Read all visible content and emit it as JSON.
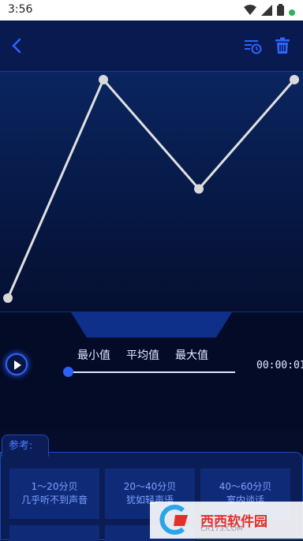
{
  "status_bar": {
    "time": "3:56",
    "icons": [
      "wifi-icon",
      "signal-icon",
      "battery-icon",
      "dot-icon"
    ]
  },
  "toolbar": {
    "back_icon": "chevron-left-icon",
    "history_icon": "history-list-icon",
    "delete_icon": "trash-icon",
    "accent_color": "#2e64ff"
  },
  "chart_data": {
    "type": "line",
    "points": [
      {
        "x": 0,
        "y": 0
      },
      {
        "x": 1,
        "y": 1
      },
      {
        "x": 2,
        "y": 0.5
      },
      {
        "x": 3,
        "y": 1
      }
    ],
    "grid": false,
    "colors": {
      "line": "#e0e0e0",
      "marker": "#d9d9d9"
    }
  },
  "stats": {
    "min_label": "最小值",
    "avg_label": "平均值",
    "max_label": "最大值"
  },
  "player": {
    "duration": "00:00:01",
    "progress": 0
  },
  "reference": {
    "tab_label": "参考:",
    "cards": [
      {
        "line1": "1～20分贝",
        "line2": "几乎听不到声音"
      },
      {
        "line1": "20～40分贝",
        "line2": "犹如轻声语"
      },
      {
        "line1": "40～60分贝",
        "line2": "室内谈话"
      }
    ]
  },
  "watermark": {
    "text": "西西软件园",
    "sub": "CR173.COM"
  }
}
